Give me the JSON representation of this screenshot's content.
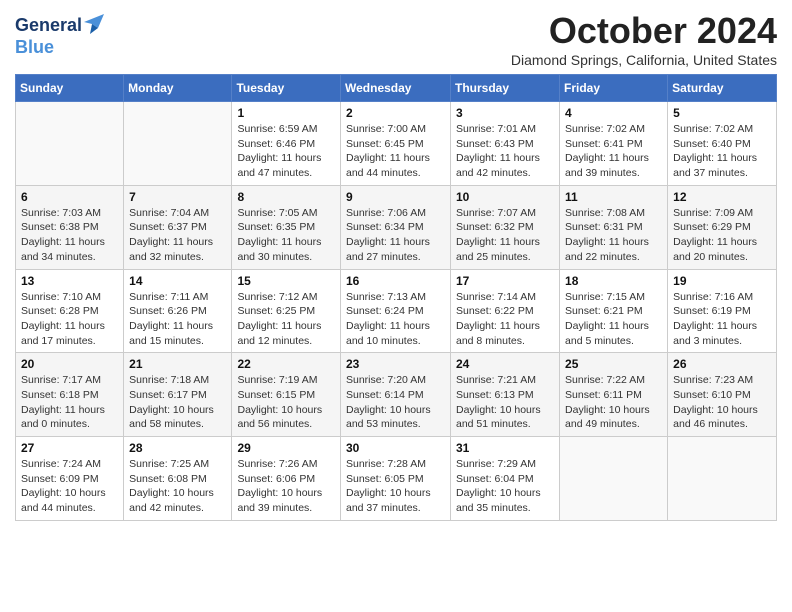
{
  "logo": {
    "line1": "General",
    "line2": "Blue"
  },
  "title": "October 2024",
  "location": "Diamond Springs, California, United States",
  "days_of_week": [
    "Sunday",
    "Monday",
    "Tuesday",
    "Wednesday",
    "Thursday",
    "Friday",
    "Saturday"
  ],
  "weeks": [
    [
      {
        "day": "",
        "info": ""
      },
      {
        "day": "",
        "info": ""
      },
      {
        "day": "1",
        "info": "Sunrise: 6:59 AM\nSunset: 6:46 PM\nDaylight: 11 hours and 47 minutes."
      },
      {
        "day": "2",
        "info": "Sunrise: 7:00 AM\nSunset: 6:45 PM\nDaylight: 11 hours and 44 minutes."
      },
      {
        "day": "3",
        "info": "Sunrise: 7:01 AM\nSunset: 6:43 PM\nDaylight: 11 hours and 42 minutes."
      },
      {
        "day": "4",
        "info": "Sunrise: 7:02 AM\nSunset: 6:41 PM\nDaylight: 11 hours and 39 minutes."
      },
      {
        "day": "5",
        "info": "Sunrise: 7:02 AM\nSunset: 6:40 PM\nDaylight: 11 hours and 37 minutes."
      }
    ],
    [
      {
        "day": "6",
        "info": "Sunrise: 7:03 AM\nSunset: 6:38 PM\nDaylight: 11 hours and 34 minutes."
      },
      {
        "day": "7",
        "info": "Sunrise: 7:04 AM\nSunset: 6:37 PM\nDaylight: 11 hours and 32 minutes."
      },
      {
        "day": "8",
        "info": "Sunrise: 7:05 AM\nSunset: 6:35 PM\nDaylight: 11 hours and 30 minutes."
      },
      {
        "day": "9",
        "info": "Sunrise: 7:06 AM\nSunset: 6:34 PM\nDaylight: 11 hours and 27 minutes."
      },
      {
        "day": "10",
        "info": "Sunrise: 7:07 AM\nSunset: 6:32 PM\nDaylight: 11 hours and 25 minutes."
      },
      {
        "day": "11",
        "info": "Sunrise: 7:08 AM\nSunset: 6:31 PM\nDaylight: 11 hours and 22 minutes."
      },
      {
        "day": "12",
        "info": "Sunrise: 7:09 AM\nSunset: 6:29 PM\nDaylight: 11 hours and 20 minutes."
      }
    ],
    [
      {
        "day": "13",
        "info": "Sunrise: 7:10 AM\nSunset: 6:28 PM\nDaylight: 11 hours and 17 minutes."
      },
      {
        "day": "14",
        "info": "Sunrise: 7:11 AM\nSunset: 6:26 PM\nDaylight: 11 hours and 15 minutes."
      },
      {
        "day": "15",
        "info": "Sunrise: 7:12 AM\nSunset: 6:25 PM\nDaylight: 11 hours and 12 minutes."
      },
      {
        "day": "16",
        "info": "Sunrise: 7:13 AM\nSunset: 6:24 PM\nDaylight: 11 hours and 10 minutes."
      },
      {
        "day": "17",
        "info": "Sunrise: 7:14 AM\nSunset: 6:22 PM\nDaylight: 11 hours and 8 minutes."
      },
      {
        "day": "18",
        "info": "Sunrise: 7:15 AM\nSunset: 6:21 PM\nDaylight: 11 hours and 5 minutes."
      },
      {
        "day": "19",
        "info": "Sunrise: 7:16 AM\nSunset: 6:19 PM\nDaylight: 11 hours and 3 minutes."
      }
    ],
    [
      {
        "day": "20",
        "info": "Sunrise: 7:17 AM\nSunset: 6:18 PM\nDaylight: 11 hours and 0 minutes."
      },
      {
        "day": "21",
        "info": "Sunrise: 7:18 AM\nSunset: 6:17 PM\nDaylight: 10 hours and 58 minutes."
      },
      {
        "day": "22",
        "info": "Sunrise: 7:19 AM\nSunset: 6:15 PM\nDaylight: 10 hours and 56 minutes."
      },
      {
        "day": "23",
        "info": "Sunrise: 7:20 AM\nSunset: 6:14 PM\nDaylight: 10 hours and 53 minutes."
      },
      {
        "day": "24",
        "info": "Sunrise: 7:21 AM\nSunset: 6:13 PM\nDaylight: 10 hours and 51 minutes."
      },
      {
        "day": "25",
        "info": "Sunrise: 7:22 AM\nSunset: 6:11 PM\nDaylight: 10 hours and 49 minutes."
      },
      {
        "day": "26",
        "info": "Sunrise: 7:23 AM\nSunset: 6:10 PM\nDaylight: 10 hours and 46 minutes."
      }
    ],
    [
      {
        "day": "27",
        "info": "Sunrise: 7:24 AM\nSunset: 6:09 PM\nDaylight: 10 hours and 44 minutes."
      },
      {
        "day": "28",
        "info": "Sunrise: 7:25 AM\nSunset: 6:08 PM\nDaylight: 10 hours and 42 minutes."
      },
      {
        "day": "29",
        "info": "Sunrise: 7:26 AM\nSunset: 6:06 PM\nDaylight: 10 hours and 39 minutes."
      },
      {
        "day": "30",
        "info": "Sunrise: 7:28 AM\nSunset: 6:05 PM\nDaylight: 10 hours and 37 minutes."
      },
      {
        "day": "31",
        "info": "Sunrise: 7:29 AM\nSunset: 6:04 PM\nDaylight: 10 hours and 35 minutes."
      },
      {
        "day": "",
        "info": ""
      },
      {
        "day": "",
        "info": ""
      }
    ]
  ]
}
